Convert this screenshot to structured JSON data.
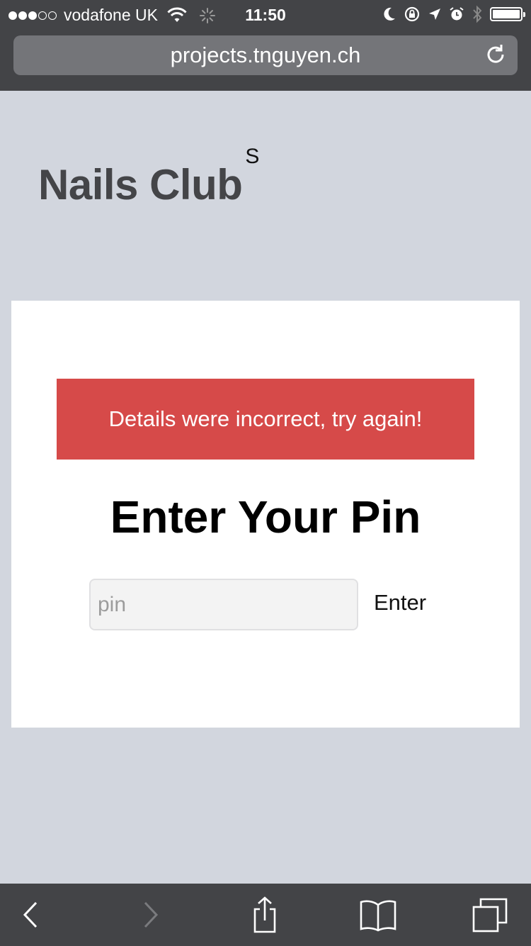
{
  "status_bar": {
    "carrier": "vodafone UK",
    "time": "11:50",
    "signal_bars_filled": 3,
    "signal_bars_total": 5
  },
  "browser": {
    "url": "projects.tnguyen.ch"
  },
  "brand": {
    "name": "Nails Club",
    "superscript": "S"
  },
  "login": {
    "error_message": "Details were incorrect, try again!",
    "heading": "Enter Your Pin",
    "pin_placeholder": "pin",
    "pin_value": "",
    "enter_label": "Enter"
  },
  "colors": {
    "error_bg": "#d64a49",
    "page_bg": "#d2d6de",
    "chrome_bg": "#434447"
  },
  "toolbar": {
    "icons": [
      "back-icon",
      "forward-icon",
      "share-icon",
      "bookmarks-icon",
      "tabs-icon"
    ]
  }
}
